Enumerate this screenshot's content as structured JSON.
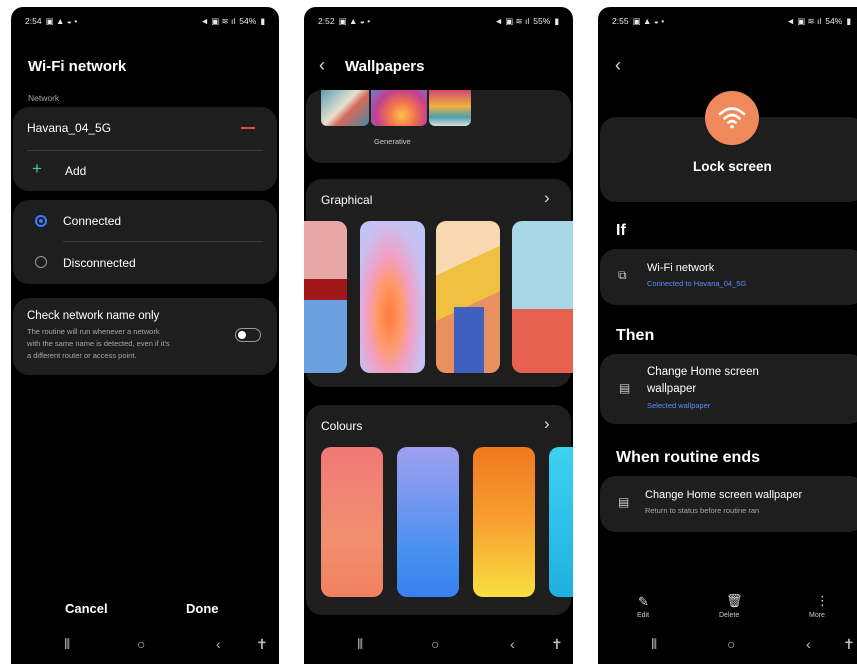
{
  "screens": {
    "wifi": {
      "status_time": "2:54",
      "status_battery": "54%",
      "title": "Wi-Fi network",
      "network_label": "Network",
      "network_name": "Havana_04_5G",
      "add_label": "Add",
      "connected_label": "Connected",
      "disconnected_label": "Disconnected",
      "check_title": "Check network name only",
      "check_desc_1": "The routine will run whenever a network",
      "check_desc_2": "with the same name is detected, even if it's",
      "check_desc_3": "a different router or access point.",
      "cancel_label": "Cancel",
      "done_label": "Done"
    },
    "wallpapers": {
      "status_time": "2:52",
      "status_battery": "55%",
      "title": "Wallpapers",
      "generative_label": "Generative",
      "graphical_label": "Graphical",
      "colours_label": "Colours"
    },
    "routine": {
      "status_time": "2:55",
      "status_battery": "54%",
      "title": "Lock screen",
      "if_label": "If",
      "wifi_title": "Wi-Fi network",
      "wifi_sub": "Connected to Havana_04_5G",
      "then_label": "Then",
      "change_title_1": "Change Home screen",
      "change_title_2": "wallpaper",
      "change_sub": "Selected wallpaper",
      "ends_label": "When routine ends",
      "end_title": "Change Home screen wallpaper",
      "end_sub": "Return to status before routine ran",
      "edit_label": "Edit",
      "delete_label": "Delete",
      "more_label": "More"
    }
  },
  "colors": {
    "accent_blue": "#3b7cff",
    "link_blue": "#5b8cff",
    "remove_red": "#e04848",
    "add_green": "#3ecf8e",
    "wifi_orange": "#f08a5d"
  }
}
